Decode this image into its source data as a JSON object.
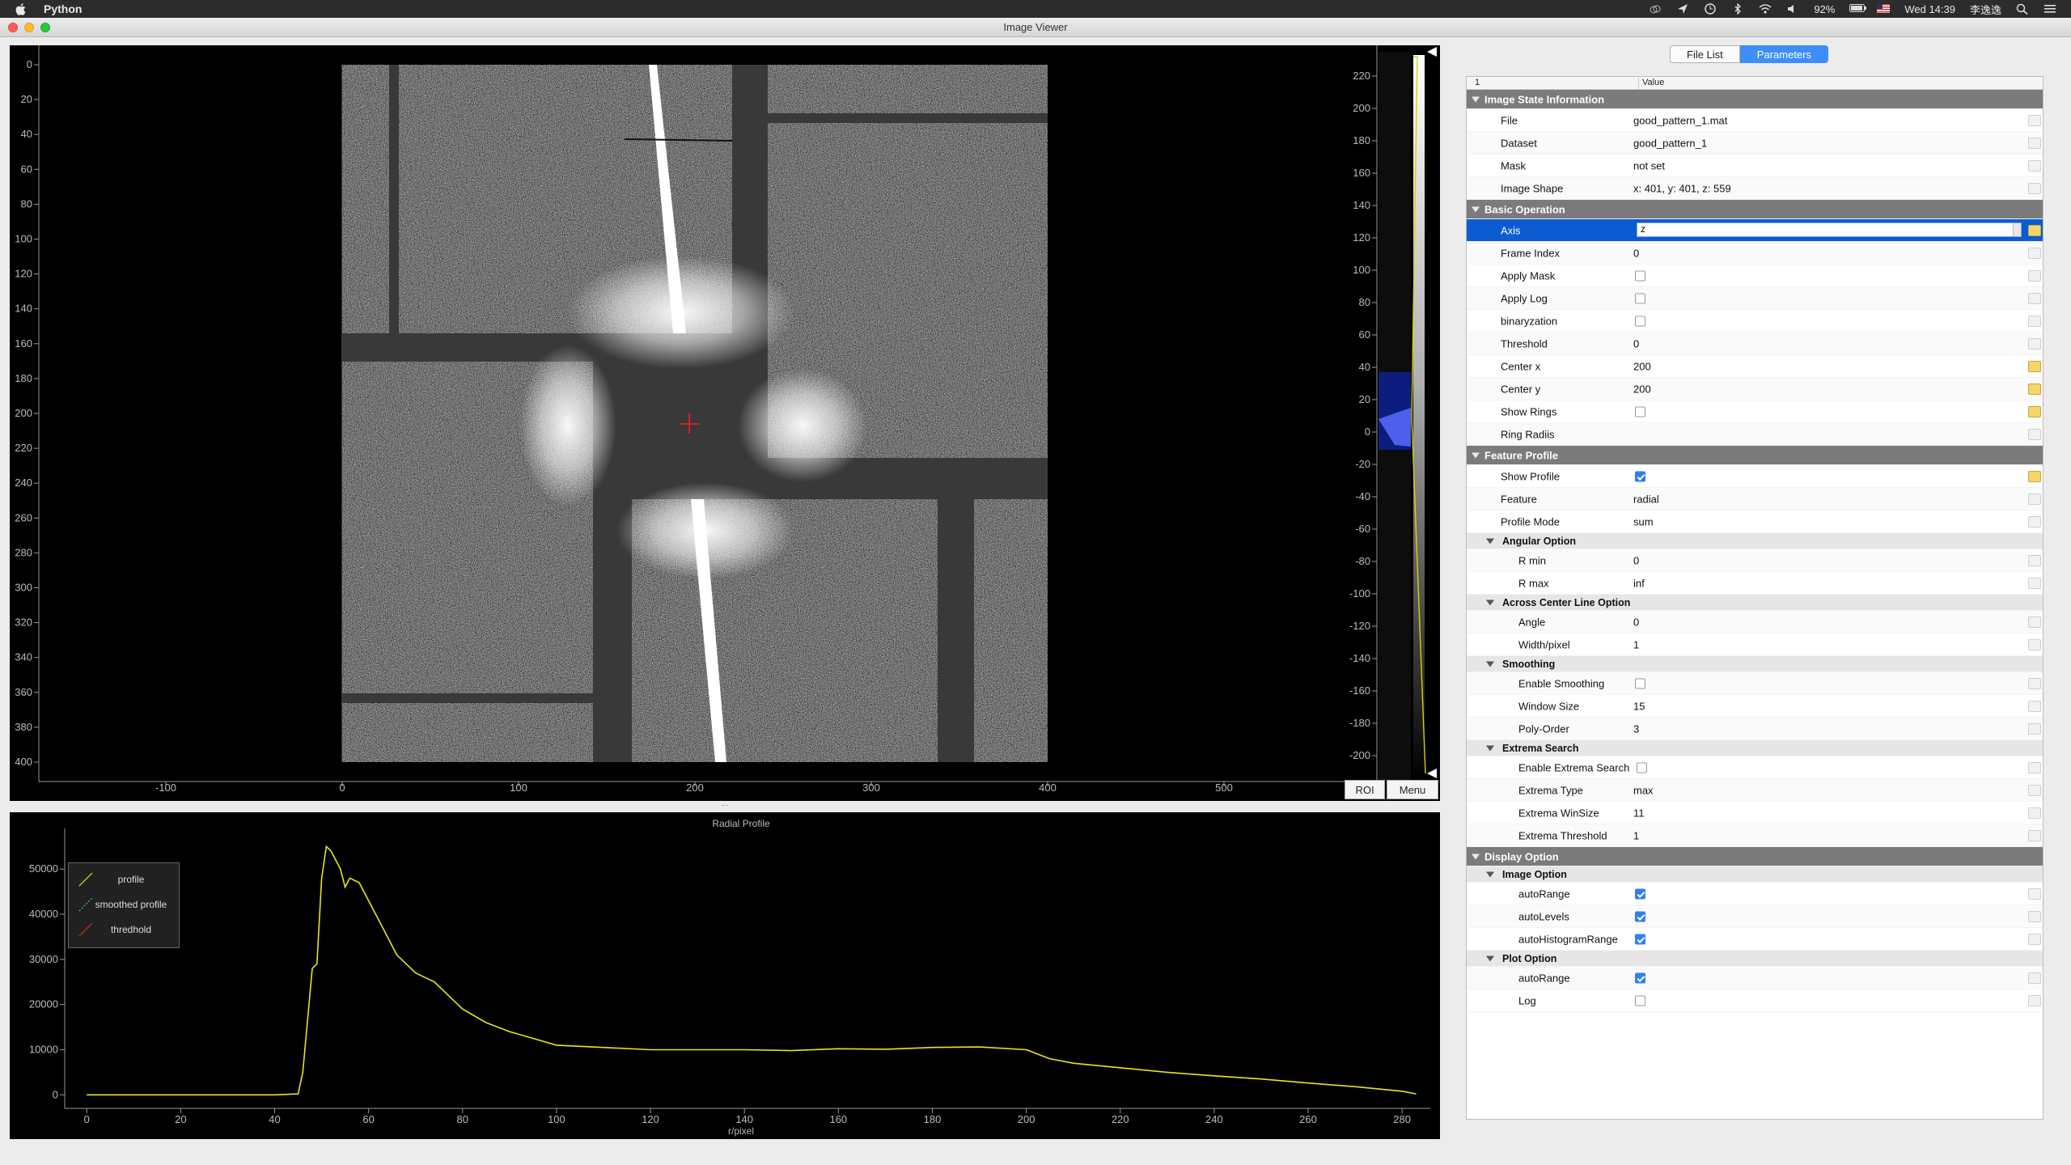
{
  "menubar": {
    "app_name": "Python",
    "battery": "92%",
    "clock": "Wed 14:39",
    "user": "李逸逸"
  },
  "window": {
    "title": "Image Viewer"
  },
  "image_view": {
    "y_ticks": [
      "0",
      "20",
      "40",
      "60",
      "80",
      "100",
      "120",
      "140",
      "160",
      "180",
      "200",
      "220",
      "240",
      "260",
      "280",
      "300",
      "320",
      "340",
      "360",
      "380",
      "400"
    ],
    "x_ticks": [
      "-100",
      "0",
      "100",
      "200",
      "300",
      "400",
      "500"
    ],
    "colorbar_ticks": [
      "220",
      "200",
      "180",
      "160",
      "140",
      "120",
      "100",
      "80",
      "60",
      "40",
      "20",
      "0",
      "-20",
      "-40",
      "-60",
      "-80",
      "-100",
      "-120",
      "-140",
      "-160",
      "-180",
      "-200"
    ],
    "roi_label": "ROI",
    "menu_label": "Menu",
    "center_marker_color": "#d22020"
  },
  "plot": {
    "title": "Radial Profile",
    "xlabel": "r/pixel",
    "legend": [
      "profile",
      "smoothed profile",
      "thredhold"
    ]
  },
  "chart_data": {
    "type": "line",
    "title": "Radial Profile",
    "xlabel": "r/pixel",
    "ylabel": "",
    "xlim": [
      -4,
      286
    ],
    "ylim": [
      -3000,
      59000
    ],
    "x_ticks": [
      0,
      20,
      40,
      60,
      80,
      100,
      120,
      140,
      160,
      180,
      200,
      220,
      240,
      260,
      280
    ],
    "y_ticks": [
      0,
      10000,
      20000,
      30000,
      40000,
      50000
    ],
    "y_tick_labels": [
      "0",
      "10000",
      "20000",
      "30000",
      "40000",
      "50000"
    ],
    "x_tick_labels": [
      "0",
      "20",
      "40",
      "60",
      "80",
      "100",
      "120",
      "140",
      "160",
      "180",
      "200",
      "220",
      "240",
      "260",
      "280"
    ],
    "series": [
      {
        "name": "profile",
        "color": "#e6e619",
        "x": [
          0,
          10,
          20,
          30,
          40,
          45,
          46,
          48,
          49,
          50,
          51,
          52,
          54,
          55,
          56,
          58,
          60,
          62,
          64,
          66,
          68,
          70,
          72,
          74,
          76,
          78,
          80,
          85,
          90,
          95,
          100,
          110,
          120,
          130,
          140,
          150,
          160,
          170,
          180,
          190,
          200,
          205,
          210,
          220,
          230,
          240,
          250,
          260,
          270,
          280,
          283
        ],
        "y": [
          0,
          0,
          0,
          0,
          0,
          200,
          5000,
          28000,
          29000,
          48000,
          55000,
          54000,
          50000,
          46000,
          48000,
          47000,
          43000,
          39000,
          35000,
          31000,
          29000,
          27000,
          26000,
          25000,
          23000,
          21000,
          19000,
          16000,
          14000,
          12500,
          11000,
          10500,
          10000,
          10000,
          10000,
          9800,
          10200,
          10100,
          10500,
          10600,
          10000,
          8000,
          7000,
          6000,
          5000,
          4200,
          3500,
          2600,
          1800,
          800,
          200
        ]
      },
      {
        "name": "smoothed profile",
        "color": "#29d46a",
        "x": [],
        "y": []
      },
      {
        "name": "thredhold",
        "color": "#d32626",
        "x": [],
        "y": []
      }
    ],
    "legend_position": "top-left",
    "grid": false
  },
  "tabs": [
    "File List",
    "Parameters"
  ],
  "tree": {
    "header": {
      "col1": "1",
      "col2": "Value"
    },
    "rows": [
      {
        "type": "group",
        "name": "Image State Information"
      },
      {
        "type": "text",
        "level": 1,
        "name": "File",
        "value": "good_pattern_1.mat"
      },
      {
        "type": "text",
        "level": 1,
        "name": "Dataset",
        "value": "good_pattern_1"
      },
      {
        "type": "text",
        "level": 1,
        "name": "Mask",
        "value": "not set"
      },
      {
        "type": "text",
        "level": 1,
        "name": "Image Shape",
        "value": "x: 401, y: 401, z: 559"
      },
      {
        "type": "group",
        "name": "Basic Operation"
      },
      {
        "type": "combo",
        "level": 1,
        "name": "Axis",
        "value": "z",
        "selected": true,
        "reset": true
      },
      {
        "type": "text",
        "level": 1,
        "name": "Frame Index",
        "value": "0"
      },
      {
        "type": "check",
        "level": 1,
        "name": "Apply Mask",
        "checked": false
      },
      {
        "type": "check",
        "level": 1,
        "name": "Apply Log",
        "checked": false
      },
      {
        "type": "check",
        "level": 1,
        "name": "binaryzation",
        "checked": false
      },
      {
        "type": "text",
        "level": 1,
        "name": "Threshold",
        "value": "0"
      },
      {
        "type": "text",
        "level": 1,
        "name": "Center x",
        "value": "200",
        "reset": true
      },
      {
        "type": "text",
        "level": 1,
        "name": "Center y",
        "value": "200",
        "reset": true
      },
      {
        "type": "check",
        "level": 1,
        "name": "Show Rings",
        "checked": false,
        "reset": true
      },
      {
        "type": "text",
        "level": 1,
        "name": "Ring Radiis",
        "value": ""
      },
      {
        "type": "group",
        "name": "Feature Profile"
      },
      {
        "type": "check",
        "level": 1,
        "name": "Show Profile",
        "checked": true,
        "reset": true
      },
      {
        "type": "text",
        "level": 1,
        "name": "Feature",
        "value": "radial"
      },
      {
        "type": "text",
        "level": 1,
        "name": "Profile Mode",
        "value": "sum"
      },
      {
        "type": "subgroup",
        "level": 1,
        "name": "Angular Option"
      },
      {
        "type": "text",
        "level": 2,
        "name": "R min",
        "value": "0"
      },
      {
        "type": "text",
        "level": 2,
        "name": "R max",
        "value": "inf"
      },
      {
        "type": "subgroup",
        "level": 1,
        "name": "Across Center Line Option"
      },
      {
        "type": "text",
        "level": 2,
        "name": "Angle",
        "value": "0"
      },
      {
        "type": "text",
        "level": 2,
        "name": "Width/pixel",
        "value": "1"
      },
      {
        "type": "subgroup",
        "level": 1,
        "name": "Smoothing"
      },
      {
        "type": "check",
        "level": 2,
        "name": "Enable Smoothing",
        "checked": false
      },
      {
        "type": "text",
        "level": 2,
        "name": "Window Size",
        "value": "15"
      },
      {
        "type": "text",
        "level": 2,
        "name": "Poly-Order",
        "value": "3"
      },
      {
        "type": "subgroup",
        "level": 1,
        "name": "Extrema Search"
      },
      {
        "type": "check",
        "level": 2,
        "name": "Enable Extrema Search",
        "checked": false,
        "inline": true
      },
      {
        "type": "text",
        "level": 2,
        "name": "Extrema Type",
        "value": "max"
      },
      {
        "type": "text",
        "level": 2,
        "name": "Extrema WinSize",
        "value": "11"
      },
      {
        "type": "text",
        "level": 2,
        "name": "Extrema Threshold",
        "value": "1"
      },
      {
        "type": "group",
        "name": "Display Option"
      },
      {
        "type": "subgroup",
        "level": 1,
        "name": "Image Option"
      },
      {
        "type": "check",
        "level": 2,
        "name": "autoRange",
        "checked": true
      },
      {
        "type": "check",
        "level": 2,
        "name": "autoLevels",
        "checked": true
      },
      {
        "type": "check",
        "level": 2,
        "name": "autoHistogramRange",
        "checked": true
      },
      {
        "type": "subgroup",
        "level": 1,
        "name": "Plot Option"
      },
      {
        "type": "check",
        "level": 2,
        "name": "autoRange",
        "checked": true
      },
      {
        "type": "check",
        "level": 2,
        "name": "Log",
        "checked": false
      }
    ]
  }
}
